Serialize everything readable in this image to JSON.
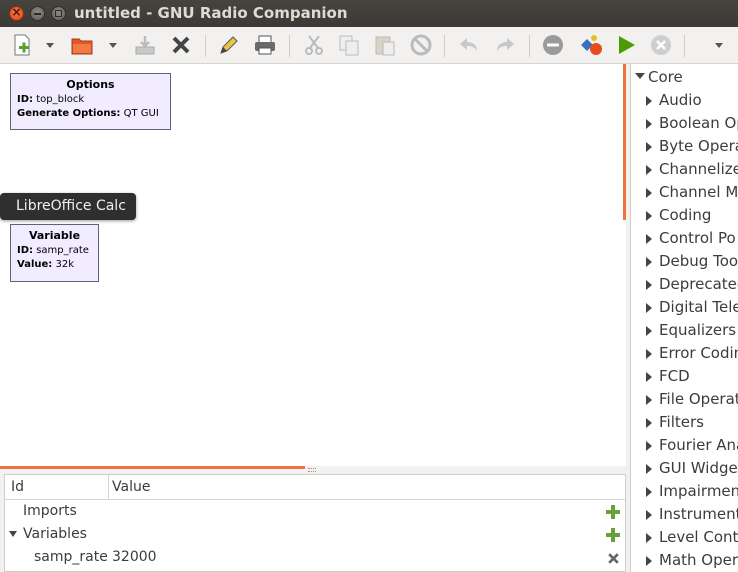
{
  "window": {
    "title": "untitled - GNU Radio Companion"
  },
  "toolbar": {
    "buttons": [
      {
        "name": "new-icon"
      },
      {
        "name": "open-icon"
      },
      {
        "name": "save-icon"
      },
      {
        "name": "close-icon"
      },
      {
        "name": "edit-icon"
      },
      {
        "name": "print-icon"
      },
      {
        "name": "cut-icon"
      },
      {
        "name": "copy-icon"
      },
      {
        "name": "paste-icon"
      },
      {
        "name": "disable-icon"
      },
      {
        "name": "undo-icon"
      },
      {
        "name": "redo-icon"
      },
      {
        "name": "kill-icon"
      },
      {
        "name": "generate-icon"
      },
      {
        "name": "execute-icon"
      },
      {
        "name": "stop-icon"
      },
      {
        "name": "dropdown-icon"
      }
    ]
  },
  "canvas": {
    "options_block": {
      "title": "Options",
      "id_label": "ID:",
      "id_value": "top_block",
      "gen_label": "Generate Options:",
      "gen_value": "QT GUI"
    },
    "variable_block": {
      "title": "Variable",
      "id_label": "ID:",
      "id_value": "samp_rate",
      "value_label": "Value:",
      "value_value": "32k"
    },
    "tooltip": "LibreOffice Calc"
  },
  "variables_panel": {
    "col_id": "Id",
    "col_value": "Value",
    "rows": [
      {
        "id": "Imports",
        "value": ""
      },
      {
        "id": "Variables",
        "value": ""
      },
      {
        "id": "samp_rate",
        "value": "32000"
      }
    ]
  },
  "block_tree": {
    "root": "Core",
    "items": [
      "Audio",
      "Boolean Op",
      "Byte Opera",
      "Channelize",
      "Channel Mo",
      "Coding",
      "Control Po",
      "Debug Too",
      "Deprecated",
      "Digital Tele",
      "Equalizers",
      "Error Codin",
      "FCD",
      "File Operat",
      "Filters",
      "Fourier Ana",
      "GUI Widget",
      "Impairmen",
      "Instrument",
      "Level Contr",
      "Math Oper"
    ]
  },
  "colors": {
    "accent": "#f0733d",
    "block_bg": "#f1ecff",
    "add_green": "#66a13a"
  }
}
